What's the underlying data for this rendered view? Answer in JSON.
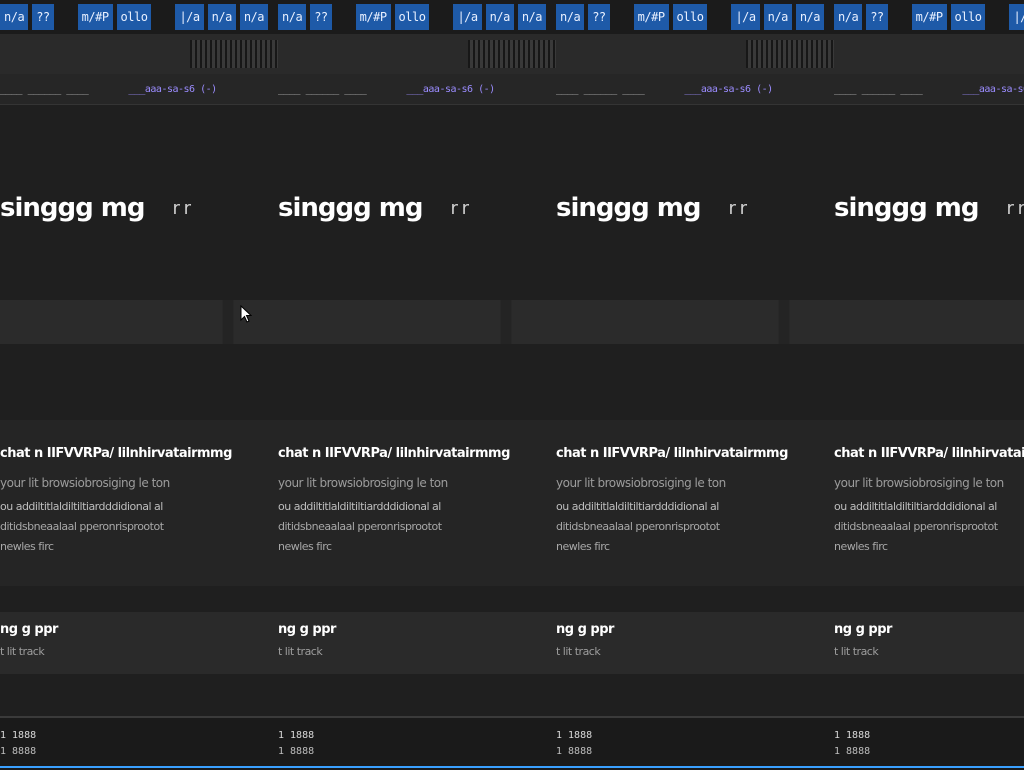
{
  "tabbar": {
    "pills": [
      "n/a",
      "??",
      "m/#P",
      "ollo",
      "|/a",
      "n/a",
      "n/a"
    ],
    "accent": "#1e5aa8"
  },
  "addressbar": {
    "text": "____ ______ ____",
    "accent_text": "___aaa-sa-s6 (-)",
    "accent": "#9b8cff"
  },
  "hero": {
    "title": "singgg mg",
    "faint": "r r"
  },
  "info": {
    "title": "chat  n IIFVVRPa/ lilnhirvatairmmg",
    "desc1": "your lit browsiobrosiging le ton",
    "desc2": "ou addiltitlaldiltiltiardddidional al",
    "desc3": "ditidsbneaalaal pperonrisprootot",
    "desc4": "newles firc"
  },
  "settings": {
    "title": "ng g ppr",
    "subtitle": "t lit track"
  },
  "status": {
    "top": "1 1888",
    "bottom": "1 8888",
    "progress_percent": 100,
    "accent": "#3aa0ff"
  }
}
